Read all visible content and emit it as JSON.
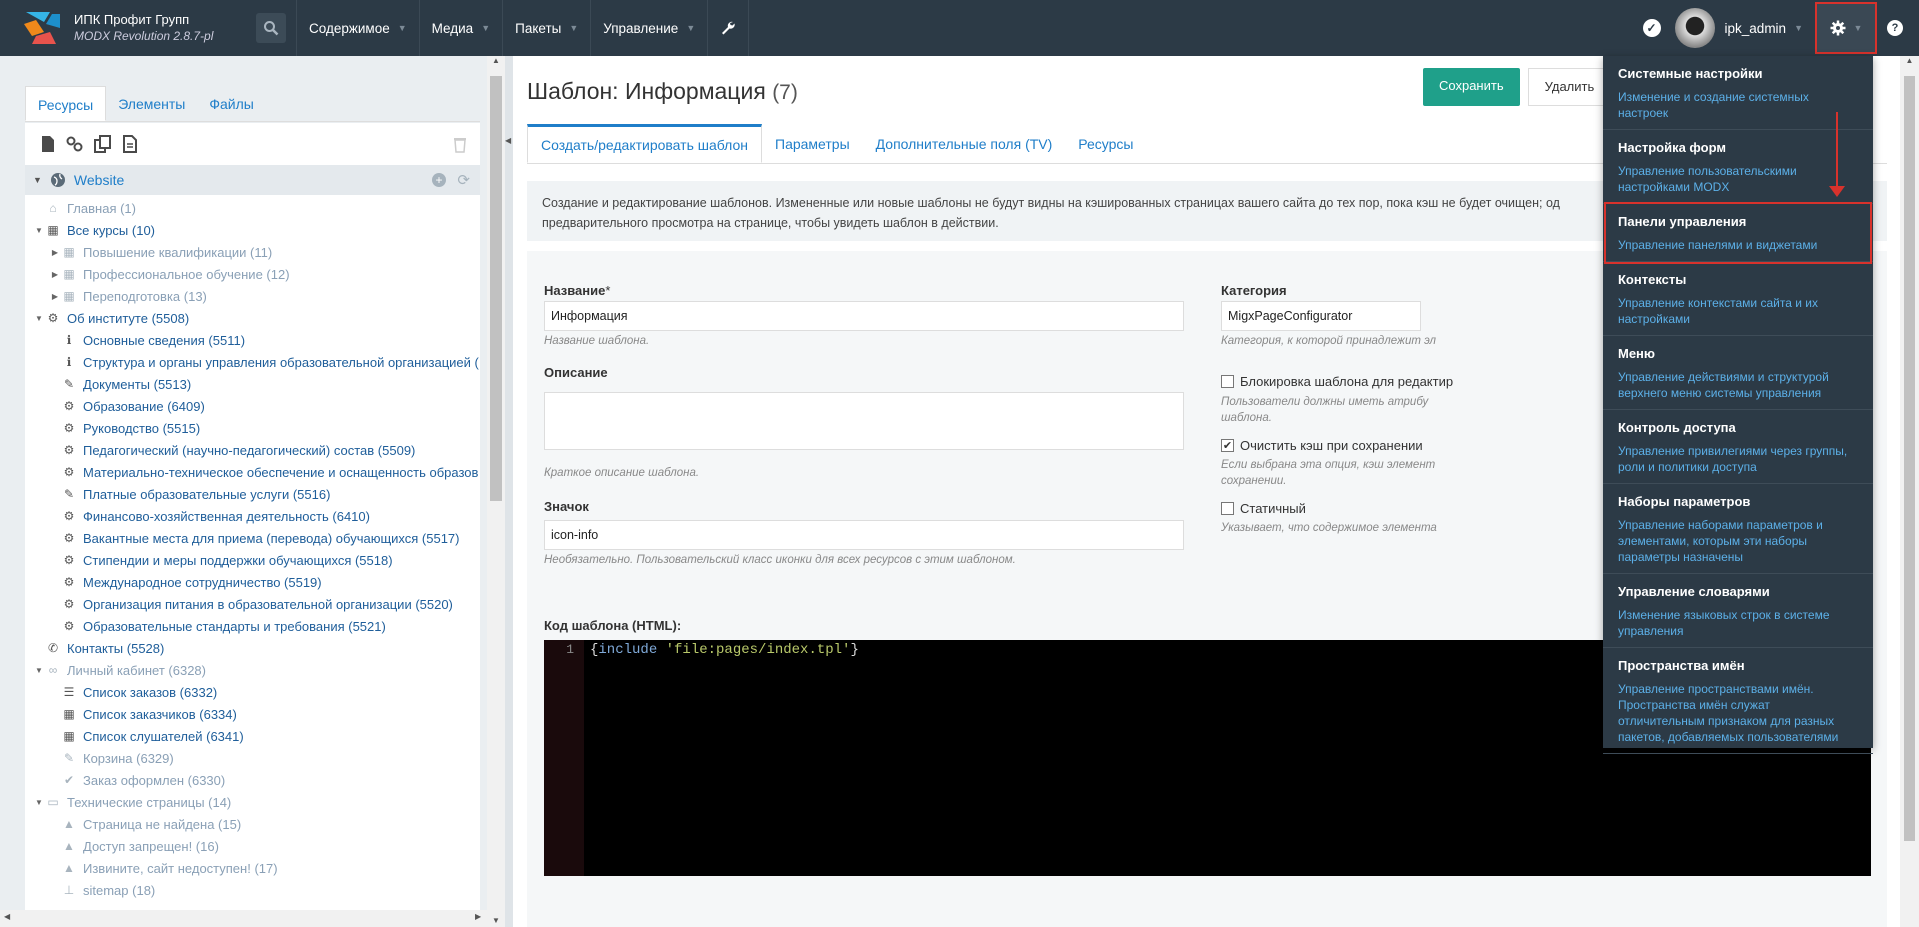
{
  "app": {
    "brand_line1": "ИПК Профит Групп",
    "brand_line2": "MODX Revolution 2.8.7-pl",
    "user": "ipk_admin"
  },
  "topnav": [
    {
      "label": "Содержимое"
    },
    {
      "label": "Медиа"
    },
    {
      "label": "Пакеты"
    },
    {
      "label": "Управление"
    }
  ],
  "left_tabs": [
    "Ресурсы",
    "Элементы",
    "Файлы"
  ],
  "tree": {
    "root": "Website",
    "items": [
      {
        "label": "Главная (1)",
        "icon": "home-icon",
        "level": 0,
        "arrow": "",
        "dim": true
      },
      {
        "label": "Все курсы (10)",
        "icon": "grid-icon",
        "level": 0,
        "arrow": "▼",
        "dim": false
      },
      {
        "label": "Повышение квалификации (11)",
        "icon": "grid-icon",
        "level": 1,
        "arrow": "▶",
        "dim": true
      },
      {
        "label": "Профессиональное обучение (12)",
        "icon": "grid-icon",
        "level": 1,
        "arrow": "▶",
        "dim": true
      },
      {
        "label": "Переподготовка (13)",
        "icon": "grid-icon",
        "level": 1,
        "arrow": "▶",
        "dim": true
      },
      {
        "label": "Об институте (5508)",
        "icon": "gears-icon",
        "level": 0,
        "arrow": "▼",
        "dim": false
      },
      {
        "label": "Основные сведения (5511)",
        "icon": "info-icon",
        "level": 1,
        "arrow": "",
        "dim": false
      },
      {
        "label": "Структура и органы управления образовательной организацией (",
        "icon": "info-icon",
        "level": 1,
        "arrow": "",
        "dim": false
      },
      {
        "label": "Документы (5513)",
        "icon": "wand-icon",
        "level": 1,
        "arrow": "",
        "dim": false
      },
      {
        "label": "Образование (6409)",
        "icon": "gears-icon",
        "level": 1,
        "arrow": "",
        "dim": false
      },
      {
        "label": "Руководство (5515)",
        "icon": "gears-icon",
        "level": 1,
        "arrow": "",
        "dim": false
      },
      {
        "label": "Педагогический (научно-педагогический) состав (5509)",
        "icon": "gears-icon",
        "level": 1,
        "arrow": "",
        "dim": false
      },
      {
        "label": "Материально-техническое обеспечение и оснащенность образов",
        "icon": "gears-icon",
        "level": 1,
        "arrow": "",
        "dim": false
      },
      {
        "label": "Платные образовательные услуги (5516)",
        "icon": "wand-icon",
        "level": 1,
        "arrow": "",
        "dim": false
      },
      {
        "label": "Финансово-хозяйственная деятельность (6410)",
        "icon": "gears-icon",
        "level": 1,
        "arrow": "",
        "dim": false
      },
      {
        "label": "Вакантные места для приема (перевода) обучающихся (5517)",
        "icon": "gears-icon",
        "level": 1,
        "arrow": "",
        "dim": false
      },
      {
        "label": "Стипендии и меры поддержки обучающихся (5518)",
        "icon": "gears-icon",
        "level": 1,
        "arrow": "",
        "dim": false
      },
      {
        "label": "Международное сотрудничество (5519)",
        "icon": "gears-icon",
        "level": 1,
        "arrow": "",
        "dim": false
      },
      {
        "label": "Организация питания в образовательной организации (5520)",
        "icon": "gears-icon",
        "level": 1,
        "arrow": "",
        "dim": false
      },
      {
        "label": "Образовательные стандарты и требования (5521)",
        "icon": "gears-icon",
        "level": 1,
        "arrow": "",
        "dim": false
      },
      {
        "label": "Контакты (5528)",
        "icon": "phone-icon",
        "level": 0,
        "arrow": "",
        "dim": false
      },
      {
        "label": "Личный кабинет (6328)",
        "icon": "link-icon",
        "level": 0,
        "arrow": "▼",
        "dim": true
      },
      {
        "label": "Список заказов (6332)",
        "icon": "list-icon",
        "level": 1,
        "arrow": "",
        "dim": false
      },
      {
        "label": "Список заказчиков (6334)",
        "icon": "grid-icon",
        "level": 1,
        "arrow": "",
        "dim": false
      },
      {
        "label": "Список слушателей (6341)",
        "icon": "grid-icon",
        "level": 1,
        "arrow": "",
        "dim": false
      },
      {
        "label": "Корзина (6329)",
        "icon": "wand-icon",
        "level": 1,
        "arrow": "",
        "dim": true
      },
      {
        "label": "Заказ оформлен (6330)",
        "icon": "check-icon",
        "level": 1,
        "arrow": "",
        "dim": true
      },
      {
        "label": "Технические страницы (14)",
        "icon": "folder-icon",
        "level": 0,
        "arrow": "▼",
        "dim": true
      },
      {
        "label": "Страница не найдена (15)",
        "icon": "warning-icon",
        "level": 1,
        "arrow": "",
        "dim": true
      },
      {
        "label": "Доступ запрещен! (16)",
        "icon": "warning-icon",
        "level": 1,
        "arrow": "",
        "dim": true
      },
      {
        "label": "Извините, сайт недоступен! (17)",
        "icon": "warning-icon",
        "level": 1,
        "arrow": "",
        "dim": true
      },
      {
        "label": "sitemap (18)",
        "icon": "sitemap-icon",
        "level": 1,
        "arrow": "",
        "dim": true
      }
    ]
  },
  "page": {
    "title": "Шаблон: Информация",
    "count": "(7)",
    "save": "Сохранить",
    "delete": "Удалить"
  },
  "main_tabs": [
    "Создать/редактировать шаблон",
    "Параметры",
    "Дополнительные поля (TV)",
    "Ресурсы"
  ],
  "description": "Создание и редактирование шаблонов. Измененные или новые шаблоны не будут видны на кэшированных страницах вашего сайта до тех пор, пока кэш не будет очищен; од",
  "description2": "предварительного просмотра на странице, чтобы увидеть шаблон в действии.",
  "form": {
    "name_label": "Название",
    "name_req": "*",
    "name_value": "Информация",
    "name_help": "Название шаблона.",
    "desc_label": "Описание",
    "desc_help": "Краткое описание шаблона.",
    "icon_label": "Значок",
    "icon_value": "icon-info",
    "icon_help": "Необязательно. Пользовательский класс иконки для всех ресурсов с этим шаблоном.",
    "code_label": "Код шаблона (HTML):",
    "category_label": "Категория",
    "category_value": "MigxPageConfigurator",
    "category_help": "Категория, к которой принадлежит эл",
    "lock_label": "Блокировка шаблона для редактир",
    "lock_help1": "Пользователи должны иметь атрибу",
    "lock_help2": "шаблона.",
    "clear_cache_label": "Очистить кэш при сохранении",
    "clear_cache_help1": "Если выбрана эта опция, кэш элемент",
    "clear_cache_help2": "сохранении.",
    "static_label": "Статичный",
    "static_help": "Указывает, что содержимое элемента"
  },
  "code": {
    "line": "1",
    "prefix": "{",
    "kw": "include",
    "str": "'file:pages/index.tpl'",
    "suffix": "}"
  },
  "dropdown": [
    {
      "title": "Системные настройки",
      "desc": "Изменение и создание системных настроек"
    },
    {
      "title": "Настройка форм",
      "desc": "Управление пользовательскими настройками MODX"
    },
    {
      "title": "Панели управления",
      "desc": "Управление панелями и виджетами"
    },
    {
      "title": "Контексты",
      "desc": "Управление контекстами сайта и их настройками"
    },
    {
      "title": "Меню",
      "desc": "Управление действиями и структурой верхнего меню системы управления"
    },
    {
      "title": "Контроль доступа",
      "desc": "Управление привилегиями через группы, роли и политики доступа"
    },
    {
      "title": "Наборы параметров",
      "desc": "Управление наборами параметров и элементами, которым эти наборы параметры назначены"
    },
    {
      "title": "Управление словарями",
      "desc": "Изменение языковых строк в системе управления"
    },
    {
      "title": "Пространства имён",
      "desc": "Управление пространствами имён. Пространства имён служат отличительным признаком для разных пакетов, добавляемых пользователями"
    }
  ],
  "colors": {
    "accent": "#1f7ec9",
    "topbar": "#2c3a46",
    "save": "#1fa08a",
    "highlight": "#d8322c"
  }
}
